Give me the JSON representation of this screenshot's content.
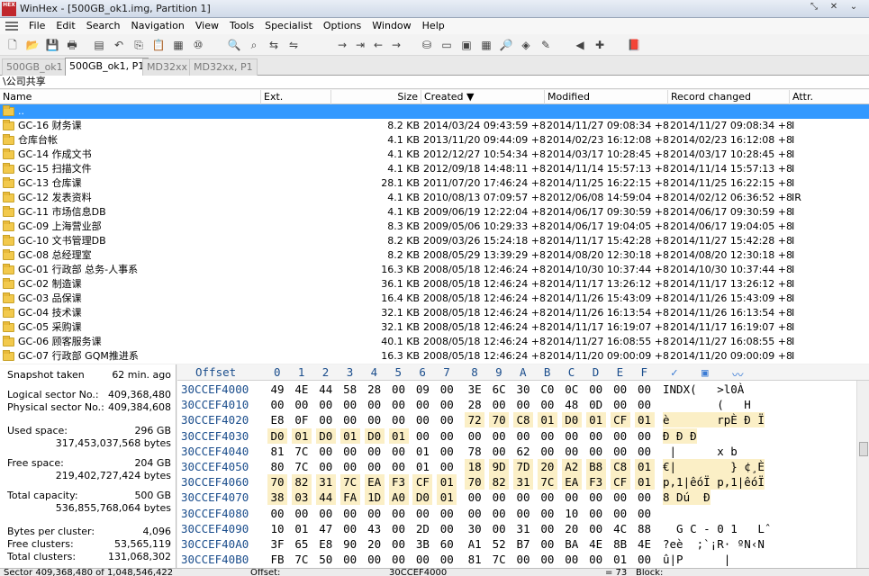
{
  "window": {
    "title": "WinHex - [500GB_ok1.img, Partition 1]",
    "logo_text": "HEX"
  },
  "menu": [
    "File",
    "Edit",
    "Search",
    "Navigation",
    "View",
    "Tools",
    "Specialist",
    "Options",
    "Window",
    "Help"
  ],
  "tabs": [
    {
      "label": "500GB_ok1",
      "active": false
    },
    {
      "label": "500GB_ok1, P1",
      "active": true
    },
    {
      "label": "MD32xx",
      "active": false
    },
    {
      "label": "MD32xx, P1",
      "active": false
    }
  ],
  "path": "\\公司共享",
  "columns": {
    "name": "Name",
    "ext": "Ext.",
    "size": "Size",
    "created": "Created",
    "modified": "Modified",
    "record_changed": "Record changed",
    "attr": "Attr."
  },
  "rows": [
    {
      "name": "..",
      "size": "",
      "created": "",
      "modified": "",
      "changed": "",
      "attr": ""
    },
    {
      "name": "GC-16 财务课",
      "size": "8.2 KB",
      "created": "2014/03/24  09:43:59  +8",
      "modified": "2014/11/27  09:08:34  +8",
      "changed": "2014/11/27  09:08:34  +8",
      "attr": "I"
    },
    {
      "name": "仓库台帐",
      "size": "4.1 KB",
      "created": "2013/11/20  09:44:09  +8",
      "modified": "2014/02/23  16:12:08  +8",
      "changed": "2014/02/23  16:12:08  +8",
      "attr": "I"
    },
    {
      "name": "GC-14 作成文书",
      "size": "4.1 KB",
      "created": "2012/12/27  10:54:34  +8",
      "modified": "2014/03/17  10:28:45  +8",
      "changed": "2014/03/17  10:28:45  +8",
      "attr": "I"
    },
    {
      "name": "GC-15 扫描文件",
      "size": "4.1 KB",
      "created": "2012/09/18  14:48:11  +8",
      "modified": "2014/11/14  15:57:13  +8",
      "changed": "2014/11/14  15:57:13  +8",
      "attr": "I"
    },
    {
      "name": "GC-13 仓库课",
      "size": "28.1 KB",
      "created": "2011/07/20  17:46:24  +8",
      "modified": "2014/11/25  16:22:15  +8",
      "changed": "2014/11/25  16:22:15  +8",
      "attr": "I"
    },
    {
      "name": "GC-12 发表资料",
      "size": "4.1 KB",
      "created": "2010/08/13  07:09:57  +8",
      "modified": "2012/06/08  14:59:04  +8",
      "changed": "2014/02/12  06:36:52  +8",
      "attr": "IR"
    },
    {
      "name": "GC-11 市场信息DB",
      "size": "4.1 KB",
      "created": "2009/06/19  12:22:04  +8",
      "modified": "2014/06/17  09:30:59  +8",
      "changed": "2014/06/17  09:30:59  +8",
      "attr": "I"
    },
    {
      "name": "GC-09 上海营业部",
      "size": "8.3 KB",
      "created": "2009/05/06  10:29:33  +8",
      "modified": "2014/06/17  19:04:05  +8",
      "changed": "2014/06/17  19:04:05  +8",
      "attr": "I"
    },
    {
      "name": "GC-10 文书管理DB",
      "size": "8.2 KB",
      "created": "2009/03/26  15:24:18  +8",
      "modified": "2014/11/17  15:42:28  +8",
      "changed": "2014/11/27  15:42:28  +8",
      "attr": "I"
    },
    {
      "name": "GC-08 总经理室",
      "size": "8.2 KB",
      "created": "2008/05/29  13:39:29  +8",
      "modified": "2014/08/20  12:30:18  +8",
      "changed": "2014/08/20  12:30:18  +8",
      "attr": "I"
    },
    {
      "name": "GC-01 行政部 总务-人事系",
      "size": "16.3 KB",
      "created": "2008/05/18  12:46:24  +8",
      "modified": "2014/10/30  10:37:44  +8",
      "changed": "2014/10/30  10:37:44  +8",
      "attr": "I"
    },
    {
      "name": "GC-02 制造课",
      "size": "36.1 KB",
      "created": "2008/05/18  12:46:24  +8",
      "modified": "2014/11/17  13:26:12  +8",
      "changed": "2014/11/17  13:26:12  +8",
      "attr": "I"
    },
    {
      "name": "GC-03 品保课",
      "size": "16.4 KB",
      "created": "2008/05/18  12:46:24  +8",
      "modified": "2014/11/26  15:43:09  +8",
      "changed": "2014/11/26  15:43:09  +8",
      "attr": "I"
    },
    {
      "name": "GC-04 技术课",
      "size": "32.1 KB",
      "created": "2008/05/18  12:46:24  +8",
      "modified": "2014/11/26  16:13:54  +8",
      "changed": "2014/11/26  16:13:54  +8",
      "attr": "I"
    },
    {
      "name": "GC-05 采购课",
      "size": "32.1 KB",
      "created": "2008/05/18  12:46:24  +8",
      "modified": "2014/11/17  16:19:07  +8",
      "changed": "2014/11/17  16:19:07  +8",
      "attr": "I"
    },
    {
      "name": "GC-06 顾客服务课",
      "size": "40.1 KB",
      "created": "2008/05/18  12:46:24  +8",
      "modified": "2014/11/27  16:08:55  +8",
      "changed": "2014/11/27  16:08:55  +8",
      "attr": "I"
    },
    {
      "name": "GC-07 行政部 GQM推进系",
      "size": "16.3 KB",
      "created": "2008/05/18  12:46:24  +8",
      "modified": "2014/11/20  09:00:09  +8",
      "changed": "2014/11/20  09:00:09  +8",
      "attr": "I"
    }
  ],
  "info": [
    {
      "label": "Snapshot taken",
      "value": "62 min. ago"
    },
    {
      "label": "Logical sector No.:",
      "value": "409,368,480"
    },
    {
      "label": "Physical sector No.:",
      "value": "409,384,608"
    },
    {
      "label": "Used space:",
      "value": "296 GB"
    },
    {
      "label": "",
      "value": "317,453,037,568 bytes"
    },
    {
      "label": "Free space:",
      "value": "204 GB"
    },
    {
      "label": "",
      "value": "219,402,727,424 bytes"
    },
    {
      "label": "Total capacity:",
      "value": "500 GB"
    },
    {
      "label": "",
      "value": "536,855,768,064 bytes"
    },
    {
      "label": "Bytes per cluster:",
      "value": "4,096"
    },
    {
      "label": "Free clusters:",
      "value": "53,565,119"
    },
    {
      "label": "Total clusters:",
      "value": "131,068,302"
    }
  ],
  "hex": {
    "offset_label": "Offset",
    "columns": [
      "0",
      "1",
      "2",
      "3",
      "4",
      "5",
      "6",
      "7",
      "8",
      "9",
      "A",
      "B",
      "C",
      "D",
      "E",
      "F"
    ],
    "rows": [
      {
        "offset": "30CCEF4000",
        "bytes": [
          "49",
          "4E",
          "44",
          "58",
          "28",
          "00",
          "09",
          "00",
          "3E",
          "6C",
          "30",
          "C0",
          "0C",
          "00",
          "00",
          "00"
        ],
        "hl_from": -1,
        "hl_to": -1,
        "ascii": "INDX(   >l0À",
        "ascii_hl": false
      },
      {
        "offset": "30CCEF4010",
        "bytes": [
          "00",
          "00",
          "00",
          "00",
          "00",
          "00",
          "00",
          "00",
          "28",
          "00",
          "00",
          "00",
          "48",
          "0D",
          "00",
          "00"
        ],
        "hl_from": -1,
        "hl_to": -1,
        "ascii": "        (   H",
        "ascii_hl": false
      },
      {
        "offset": "30CCEF4020",
        "bytes": [
          "E8",
          "0F",
          "00",
          "00",
          "00",
          "00",
          "00",
          "00",
          "72",
          "70",
          "C8",
          "01",
          "D0",
          "01",
          "CF",
          "01"
        ],
        "hl_from": 8,
        "hl_to": 15,
        "ascii": "è       rpÈ Ð Ï",
        "ascii_hl": true
      },
      {
        "offset": "30CCEF4030",
        "bytes": [
          "D0",
          "01",
          "D0",
          "01",
          "D0",
          "01",
          "00",
          "00",
          "00",
          "00",
          "00",
          "00",
          "00",
          "00",
          "00",
          "00"
        ],
        "hl_from": 0,
        "hl_to": 5,
        "ascii": "Ð Ð Ð",
        "ascii_hl": true
      },
      {
        "offset": "30CCEF4040",
        "bytes": [
          "81",
          "7C",
          "00",
          "00",
          "00",
          "00",
          "01",
          "00",
          "78",
          "00",
          "62",
          "00",
          "00",
          "00",
          "00",
          "00"
        ],
        "hl_from": -1,
        "hl_to": -1,
        "ascii": " |      x b",
        "ascii_hl": false
      },
      {
        "offset": "30CCEF4050",
        "bytes": [
          "80",
          "7C",
          "00",
          "00",
          "00",
          "00",
          "01",
          "00",
          "18",
          "9D",
          "7D",
          "20",
          "A2",
          "B8",
          "C8",
          "01"
        ],
        "hl_from": 8,
        "hl_to": 15,
        "ascii": "€|        } ¢¸È",
        "ascii_hl": true
      },
      {
        "offset": "30CCEF4060",
        "bytes": [
          "70",
          "82",
          "31",
          "7C",
          "EA",
          "F3",
          "CF",
          "01",
          "70",
          "82",
          "31",
          "7C",
          "EA",
          "F3",
          "CF",
          "01"
        ],
        "hl_from": 0,
        "hl_to": 15,
        "ascii": "p‚1|êóÏ p‚1|êóÏ",
        "ascii_hl": true
      },
      {
        "offset": "30CCEF4070",
        "bytes": [
          "38",
          "03",
          "44",
          "FA",
          "1D",
          "A0",
          "D0",
          "01",
          "00",
          "00",
          "00",
          "00",
          "00",
          "00",
          "00",
          "00"
        ],
        "hl_from": 0,
        "hl_to": 7,
        "ascii": "8 Dú  Ð",
        "ascii_hl": true
      },
      {
        "offset": "30CCEF4080",
        "bytes": [
          "00",
          "00",
          "00",
          "00",
          "00",
          "00",
          "00",
          "00",
          "00",
          "00",
          "00",
          "00",
          "10",
          "00",
          "00",
          "00"
        ],
        "hl_from": -1,
        "hl_to": -1,
        "ascii": "",
        "ascii_hl": false
      },
      {
        "offset": "30CCEF4090",
        "bytes": [
          "10",
          "01",
          "47",
          "00",
          "43",
          "00",
          "2D",
          "00",
          "30",
          "00",
          "31",
          "00",
          "20",
          "00",
          "4C",
          "88"
        ],
        "hl_from": -1,
        "hl_to": -1,
        "ascii": "  G C - 0 1   Lˆ",
        "ascii_hl": false
      },
      {
        "offset": "30CCEF40A0",
        "bytes": [
          "3F",
          "65",
          "E8",
          "90",
          "20",
          "00",
          "3B",
          "60",
          "A1",
          "52",
          "B7",
          "00",
          "BA",
          "4E",
          "8B",
          "4E"
        ],
        "hl_from": -1,
        "hl_to": -1,
        "ascii": "?eè  ;`¡R· ºN‹N",
        "ascii_hl": false
      },
      {
        "offset": "30CCEF40B0",
        "bytes": [
          "FB",
          "7C",
          "50",
          "00",
          "00",
          "00",
          "00",
          "00",
          "81",
          "7C",
          "00",
          "00",
          "00",
          "00",
          "01",
          "00"
        ],
        "hl_from": -1,
        "hl_to": -1,
        "ascii": "û|P      |",
        "ascii_hl": false
      }
    ]
  },
  "status": {
    "sector": "Sector 409,368,480 of 1,048,546,422",
    "offset_label": "Offset:",
    "offset_value": "30CCEF4000",
    "value": "= 73",
    "block_label": "Block:"
  }
}
